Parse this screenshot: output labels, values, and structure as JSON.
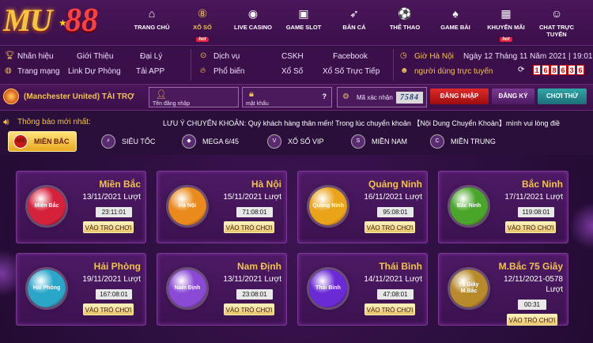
{
  "brand": {
    "logo_text": "MU",
    "logo_number": "88"
  },
  "nav": [
    {
      "label": "TRANG CHỦ",
      "icon": "home-icon",
      "glyph": "⌂"
    },
    {
      "label": "XỔ SỐ",
      "icon": "lottery-ball-icon",
      "glyph": "⑧",
      "hot": "hot"
    },
    {
      "label": "LIVE CASINO",
      "icon": "casino-chip-icon",
      "glyph": "◉"
    },
    {
      "label": "GAME SLOT",
      "icon": "slot-machine-icon",
      "glyph": "▣"
    },
    {
      "label": "BẮN CÁ",
      "icon": "fish-icon",
      "glyph": "➶"
    },
    {
      "label": "THỂ THAO",
      "icon": "soccer-ball-icon",
      "glyph": "⚽"
    },
    {
      "label": "GAME BÀI",
      "icon": "playing-card-icon",
      "glyph": "♠"
    },
    {
      "label": "KHUYẾN MÃI",
      "icon": "gift-icon",
      "glyph": "▦",
      "hot": "hot"
    },
    {
      "label": "CHAT TRỰC TUYẾN",
      "icon": "support-agent-icon",
      "glyph": "☺"
    }
  ],
  "links": {
    "nhan_hieu": "Nhãn hiệu",
    "gioi_thieu": "Giới Thiệu",
    "dai_ly": "Đại Lý",
    "trang_mang": "Trang mạng",
    "link_du_phong": "Link Dự Phòng",
    "tai_app": "Tải APP",
    "dich_vu": "Dịch vụ",
    "cskh": "CSKH",
    "facebook": "Facebook",
    "pho_bien": "Phổ biến",
    "xo_so": "Xổ Số",
    "xo_so_truc_tiep": "Xổ Số Trực Tiếp",
    "gio": "Giờ Hà Nội",
    "date": "Ngày 12 Tháng 11 Năm 2021 | 19:01",
    "online": "người dùng trực tuyến",
    "online_digits": [
      "1",
      "6",
      "8",
      "6",
      "3",
      "6"
    ]
  },
  "login": {
    "sponsor": "(Manchester United) TÀI TRỢ",
    "username_label": "Tên đăng nhập",
    "password_label": "mật khẩu",
    "captcha_label": "Mã xác nhận",
    "captcha_value": "7584",
    "login_btn": "ĐĂNG NHẬP",
    "register_btn": "ĐĂNG KÝ",
    "try_btn": "CHƠI THỬ",
    "help": "?"
  },
  "notice": {
    "title": "Thông báo mới nhất:",
    "ticker": "LƯU Ý CHUYỂN KHOẢN:   Quý khách hàng thân mến! Trong lúc chuyển khoản 【Nội Dung Chuyển Khoản】mình vui lòng điề"
  },
  "tabs": [
    {
      "label": "MIỀN BẮC",
      "icon": "north-region-icon",
      "badge": "MB"
    },
    {
      "label": "SIÊU TỐC",
      "icon": "lightning-icon",
      "badge": "⚡"
    },
    {
      "label": "MEGA 6/45",
      "icon": "mega-icon",
      "badge": "◆"
    },
    {
      "label": "XỔ SỐ VIP",
      "icon": "vip-icon",
      "badge": "V"
    },
    {
      "label": "MIỀN NAM",
      "icon": "south-region-icon",
      "badge": "S"
    },
    {
      "label": "MIỀN TRUNG",
      "icon": "central-region-icon",
      "badge": "C"
    }
  ],
  "cards": [
    {
      "name": "Miền Bắc",
      "date": "13/11/2021 Lượt",
      "timer": "23:11:01",
      "play": "VÀO TRÒ CHƠI",
      "ball": "Miền Bắc",
      "color": "#d6213a"
    },
    {
      "name": "Hà Nội",
      "date": "15/11/2021 Lượt",
      "timer": "71:08:01",
      "play": "VÀO TRÒ CHƠI",
      "ball": "Hà Nội",
      "color": "#e98a1a"
    },
    {
      "name": "Quảng Ninh",
      "date": "16/11/2021 Lượt",
      "timer": "95:08:01",
      "play": "VÀO TRÒ CHƠI",
      "ball": "Quảng Ninh",
      "color": "#e9a41a"
    },
    {
      "name": "Bắc Ninh",
      "date": "17/11/2021 Lượt",
      "timer": "119:08:01",
      "play": "VÀO TRÒ CHƠI",
      "ball": "Bắc Ninh",
      "color": "#4aa62a"
    },
    {
      "name": "Hải Phòng",
      "date": "19/11/2021 Lượt",
      "timer": "167:08:01",
      "play": "VÀO TRÒ CHƠI",
      "ball": "Hải Phòng",
      "color": "#2aa6c9"
    },
    {
      "name": "Nam Định",
      "date": "13/11/2021 Lượt",
      "timer": "23:08:01",
      "play": "VÀO TRÒ CHƠI",
      "ball": "Nam Định",
      "color": "#8a4ad6"
    },
    {
      "name": "Thái Bình",
      "date": "14/11/2021 Lượt",
      "timer": "47:08:01",
      "play": "VÀO TRÒ CHƠI",
      "ball": "Thái Bình",
      "color": "#6a2ad6"
    },
    {
      "name": "M.Bắc 75 Giây",
      "date": "12/11/2021-0578",
      "date2": "Lượt",
      "timer": "00:31",
      "play": "VÀO TRÒ CHƠI",
      "ball": "75 Giây M.Bắc",
      "color": "#b88a2a"
    }
  ]
}
